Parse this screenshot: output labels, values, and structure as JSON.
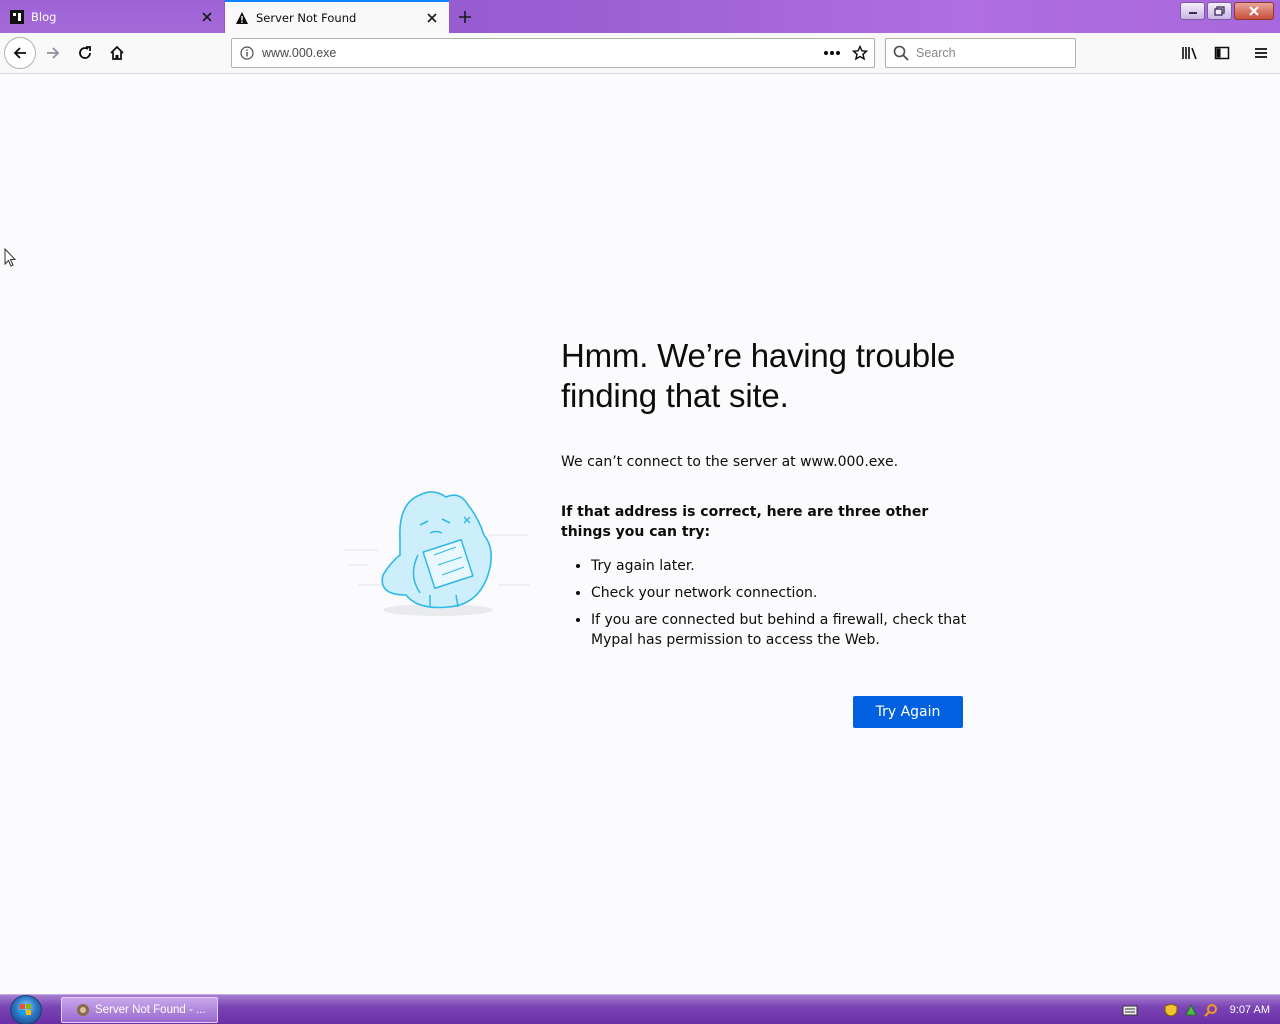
{
  "browser": {
    "tabs": [
      {
        "title": "Blog",
        "active": false
      },
      {
        "title": "Server Not Found",
        "active": true
      }
    ],
    "url": "www.000.exe",
    "search_placeholder": "Search",
    "accent_color": "#0a84ff"
  },
  "error_page": {
    "heading": "Hmm. We’re having trouble finding that site.",
    "description": "We can’t connect to the server at www.000.exe.",
    "advice_title": "If that address is correct, here are three other things you can try:",
    "suggestions": [
      "Try again later.",
      "Check your network connection.",
      "If you are connected but behind a firewall, check that Mypal has permission to access the Web."
    ],
    "try_again_label": "Try Again",
    "button_color": "#0060df"
  },
  "taskbar": {
    "task_label": "Server Not Found - ...",
    "clock": "9:07 AM"
  }
}
